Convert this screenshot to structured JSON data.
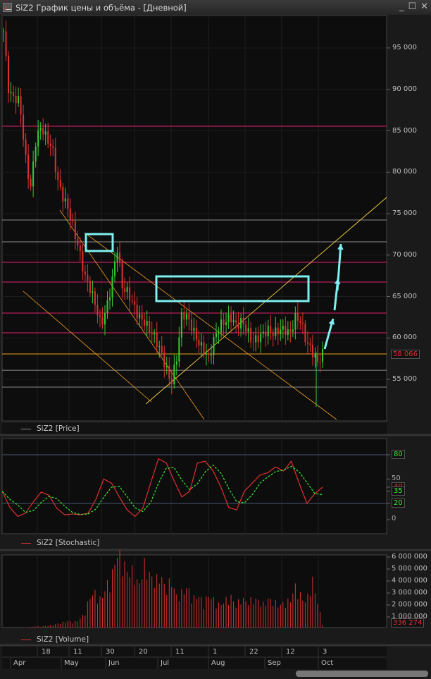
{
  "window": {
    "title": "SiZ2 График цены и объёма - [Дневной]",
    "minimize": "_",
    "maximize": "☐",
    "close": "✕"
  },
  "colors": {
    "bg": "#0d0d0d",
    "up": "#33cc33",
    "down": "#e03030",
    "level": "#e0206a",
    "trend": "#f0a020",
    "highlight": "#7ff0f0"
  },
  "price_panel": {
    "legend": "SiZ2 [Price]",
    "axis_labels": [
      "95 000",
      "90 000",
      "85 000",
      "80 000",
      "75 000",
      "70 000",
      "65 000",
      "60 000",
      "55 000"
    ],
    "last_price": "58 066",
    "levels": [
      85550,
      74230,
      71600,
      69130,
      66750,
      63000,
      60620,
      58066,
      56100,
      54060
    ],
    "closes": [
      97000,
      89500,
      89000,
      88500,
      82000,
      78000,
      84000,
      85500,
      84000,
      83000,
      79000,
      77000,
      75500,
      73000,
      70500,
      67500,
      66000,
      64000,
      61500,
      63500,
      66500,
      71000,
      66000,
      65500,
      64000,
      62500,
      62000,
      61000,
      60000,
      58500,
      56500,
      54500,
      57500,
      63000,
      62500,
      61000,
      59500,
      58500,
      57500,
      60000,
      61500,
      62000,
      62500,
      61500,
      62000,
      61000,
      59500,
      60000,
      60500,
      61000,
      60500,
      61000,
      61000,
      60500,
      62500,
      62000,
      59500,
      58500,
      57000,
      58066
    ]
  },
  "stochastic_panel": {
    "legend": "SiZ2 [Stochastic]",
    "axis_labels": [
      "80",
      "50",
      "40",
      "35",
      "20",
      "0"
    ],
    "k": [
      35,
      15,
      4,
      8,
      22,
      34,
      30,
      14,
      6,
      7,
      6,
      8,
      25,
      50,
      45,
      28,
      12,
      4,
      14,
      45,
      75,
      70,
      48,
      28,
      35,
      70,
      72,
      60,
      40,
      15,
      12,
      35,
      45,
      55,
      58,
      65,
      60,
      72,
      45,
      20,
      32,
      40
    ]
  },
  "volume_panel": {
    "legend": "SiZ2 [Volume]",
    "axis_labels": [
      "6 000 000",
      "5 000 000",
      "4 000 000",
      "3 000 000",
      "2 000 000",
      "1 000 000"
    ],
    "last_volume": "336 274",
    "volumes": [
      0.1,
      0.1,
      0.1,
      0.12,
      0.1,
      0.15,
      0.2,
      0.2,
      0.25,
      0.3,
      0.4,
      0.5,
      0.6,
      0.5,
      0.7,
      1.2,
      2.5,
      2.8,
      2.2,
      3.3,
      4.0,
      5.9,
      5.2,
      4.3,
      4.5,
      3.2,
      5.0,
      4.2,
      3.6,
      4.2,
      3.0,
      3.8,
      2.5,
      2.8,
      3.2,
      2.3,
      2.6,
      2.0,
      2.6,
      2.2,
      1.8,
      2.2,
      2.5,
      1.8,
      2.4,
      2.0,
      2.3,
      2.2,
      1.9,
      2.3,
      2.1,
      1.8,
      2.0,
      2.2,
      3.3,
      2.5,
      2.0,
      4.0,
      2.2,
      0.34
    ]
  },
  "time_axis": {
    "days": [
      "18",
      "11",
      "30",
      "20",
      "11",
      "1",
      "22",
      "12",
      "3"
    ],
    "months": [
      "Apr",
      "May",
      "Jun",
      "Jul",
      "Aug",
      "Sep",
      "Oct"
    ]
  }
}
